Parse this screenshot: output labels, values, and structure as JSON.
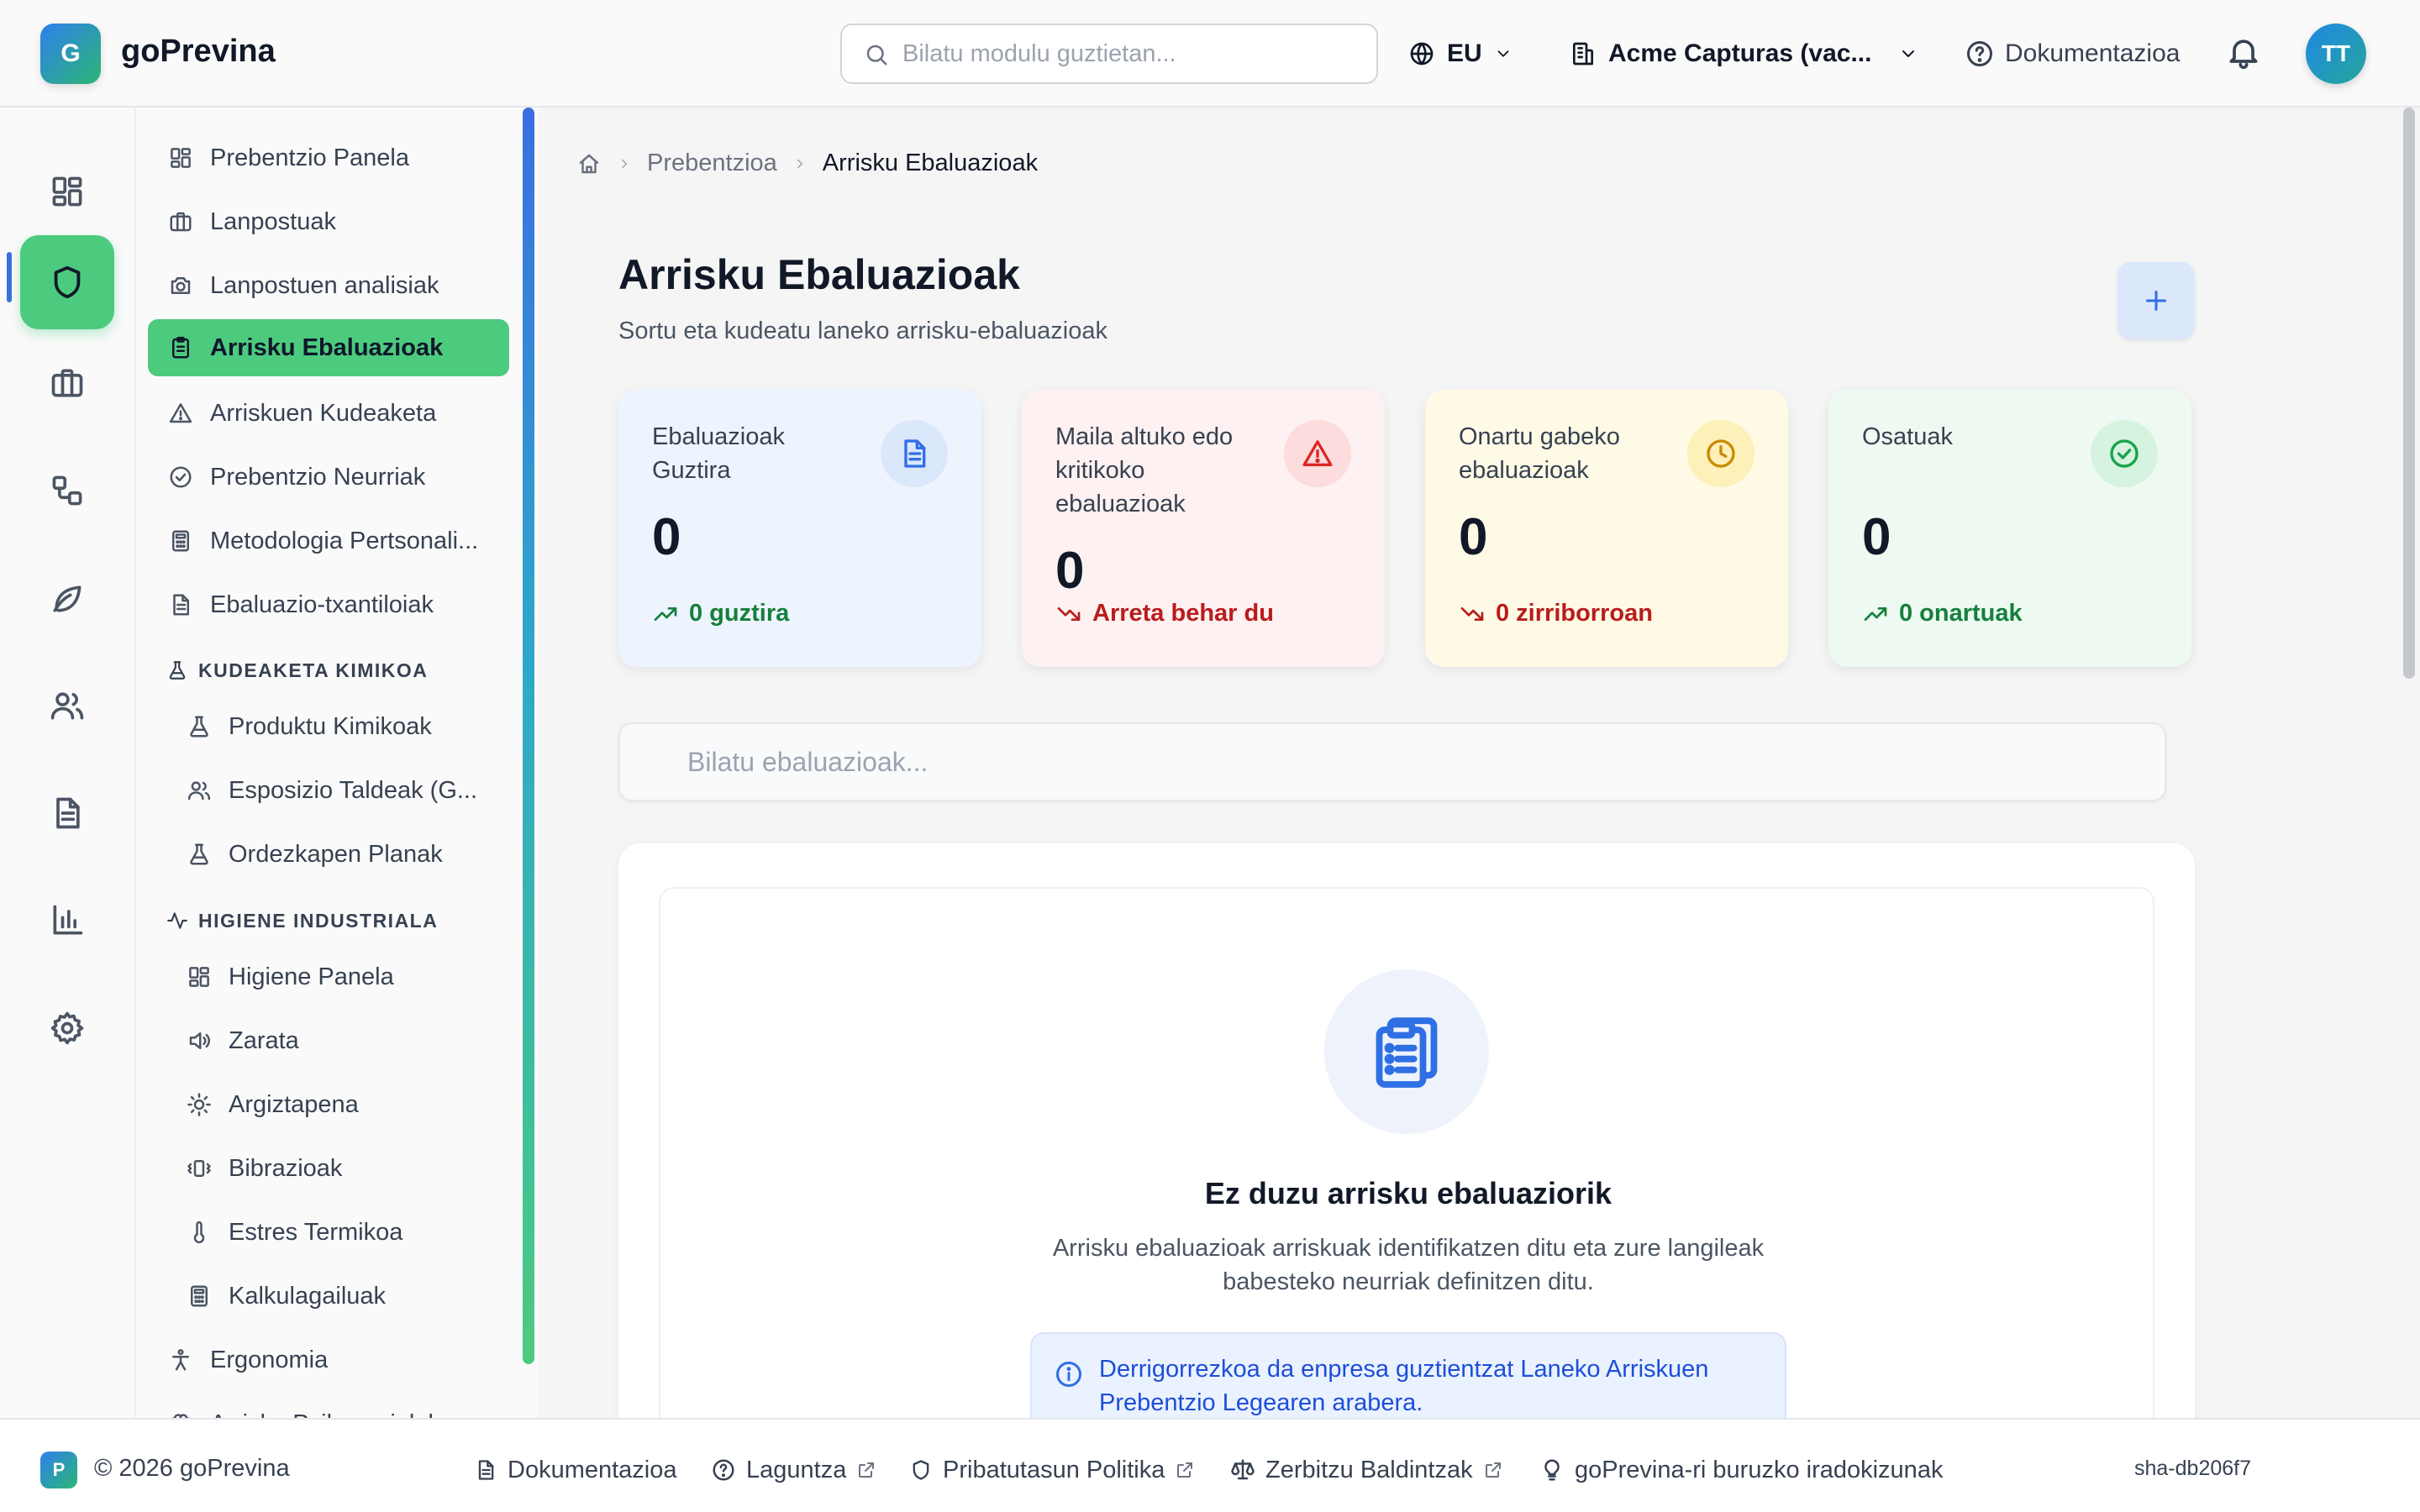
{
  "app": {
    "logo_letter": "G",
    "name": "goPrevina"
  },
  "header": {
    "search_placeholder": "Bilatu modulu guztietan...",
    "language": "EU",
    "company": "Acme Capturas (vac...",
    "docs_label": "Dokumentazioa",
    "user_initials": "TT"
  },
  "rail": {
    "items": [
      {
        "icon": "dashboard-icon"
      },
      {
        "icon": "shield-icon",
        "active": true
      },
      {
        "icon": "briefcase-icon"
      },
      {
        "icon": "workflow-icon"
      },
      {
        "icon": "leaf-icon"
      },
      {
        "icon": "users-icon"
      },
      {
        "icon": "document-icon"
      },
      {
        "icon": "bar-chart-icon"
      },
      {
        "icon": "gear-icon"
      }
    ]
  },
  "sidebar": {
    "items": [
      {
        "label": "Prebentzio Panela",
        "icon": "dashboard-icon"
      },
      {
        "label": "Lanpostuak",
        "icon": "briefcase-icon"
      },
      {
        "label": "Lanpostuen analisiak",
        "icon": "camera-icon"
      },
      {
        "label": "Arrisku Ebaluazioak",
        "icon": "clipboard-icon",
        "active": true
      },
      {
        "label": "Arriskuen Kudeaketa",
        "icon": "warning-icon"
      },
      {
        "label": "Prebentzio Neurriak",
        "icon": "check-circle-icon"
      },
      {
        "label": "Metodologia Pertsonali...",
        "icon": "calculator-icon"
      },
      {
        "label": "Ebaluazio-txantiloiak",
        "icon": "file-icon"
      }
    ],
    "section_chemical": {
      "title": "KUDEAKETA KIMIKOA",
      "items": [
        {
          "label": "Produktu Kimikoak",
          "icon": "flask-icon"
        },
        {
          "label": "Esposizio Taldeak (G...",
          "icon": "users-icon"
        },
        {
          "label": "Ordezkapen Planak",
          "icon": "flask-icon"
        }
      ]
    },
    "section_hygiene": {
      "title": "HIGIENE INDUSTRIALA",
      "items": [
        {
          "label": "Higiene Panela",
          "icon": "dashboard-icon"
        },
        {
          "label": "Zarata",
          "icon": "speaker-icon"
        },
        {
          "label": "Argiztapena",
          "icon": "sun-icon"
        },
        {
          "label": "Bibrazioak",
          "icon": "vibration-icon"
        },
        {
          "label": "Estres Termikoa",
          "icon": "thermometer-icon"
        },
        {
          "label": "Kalkulagailuak",
          "icon": "calculator-icon"
        }
      ]
    },
    "ergonomics": {
      "label": "Ergonomia",
      "icon": "person-icon"
    },
    "cut_off_item": {
      "label": "Arrisku Psikosozialak",
      "icon": "brain-icon"
    }
  },
  "breadcrumb": {
    "parent": "Prebentzioa",
    "current": "Arrisku Ebaluazioak"
  },
  "page": {
    "title": "Arrisku Ebaluazioak",
    "subtitle": "Sortu eta kudeatu laneko arrisku-ebaluazioak"
  },
  "stats": [
    {
      "label": "Ebaluazioak Guztira",
      "value": "0",
      "trend": "0 guztira",
      "trend_dir": "up",
      "bg": "#eef4fe",
      "bubble": "#dbe7fb",
      "accent": "#2f6fe4",
      "trend_color": "#15803d",
      "icon": "file-icon"
    },
    {
      "label": "Maila altuko edo kritikoko ebaluazioak",
      "value": "0",
      "trend": "Arreta behar du",
      "trend_dir": "down",
      "bg": "#fef1f1",
      "bubble": "#fcdcdc",
      "accent": "#dc2626",
      "trend_color": "#b91c1c",
      "icon": "warning-icon"
    },
    {
      "label": "Onartu gabeko ebaluazioak",
      "value": "0",
      "trend": "0 zirriborroan",
      "trend_dir": "down",
      "bg": "#fefae6",
      "bubble": "#fdf0b8",
      "accent": "#ca8a04",
      "trend_color": "#b91c1c",
      "icon": "clock-icon"
    },
    {
      "label": "Osatuak",
      "value": "0",
      "trend": "0 onartuak",
      "trend_dir": "up",
      "bg": "#eefaf1",
      "bubble": "#d6f3df",
      "accent": "#16a34a",
      "trend_color": "#15803d",
      "icon": "check-circle-icon"
    }
  ],
  "filter": {
    "placeholder": "Bilatu ebaluazioak..."
  },
  "empty": {
    "title": "Ez duzu arrisku ebaluaziorik",
    "description": "Arrisku ebaluazioak arriskuak identifikatzen ditu eta zure langileak babesteko neurriak definitzen ditu.",
    "info": "Derrigorrezkoa da enpresa guztientzat Laneko Arriskuen Prebentzio Legearen arabera."
  },
  "footer": {
    "logo_letter": "P",
    "copyright": "© 2026 goPrevina",
    "links": [
      {
        "label": "Dokumentazioa",
        "icon": "file-icon",
        "external": false
      },
      {
        "label": "Laguntza",
        "icon": "help-icon",
        "external": true
      },
      {
        "label": "Pribatutasun Politika",
        "icon": "shield-icon",
        "external": true
      },
      {
        "label": "Zerbitzu Baldintzak",
        "icon": "scale-icon",
        "external": true
      },
      {
        "label": "goPrevina-ri buruzko iradokizunak",
        "icon": "lightbulb-icon",
        "external": false
      }
    ],
    "version": "sha-db206f7"
  }
}
